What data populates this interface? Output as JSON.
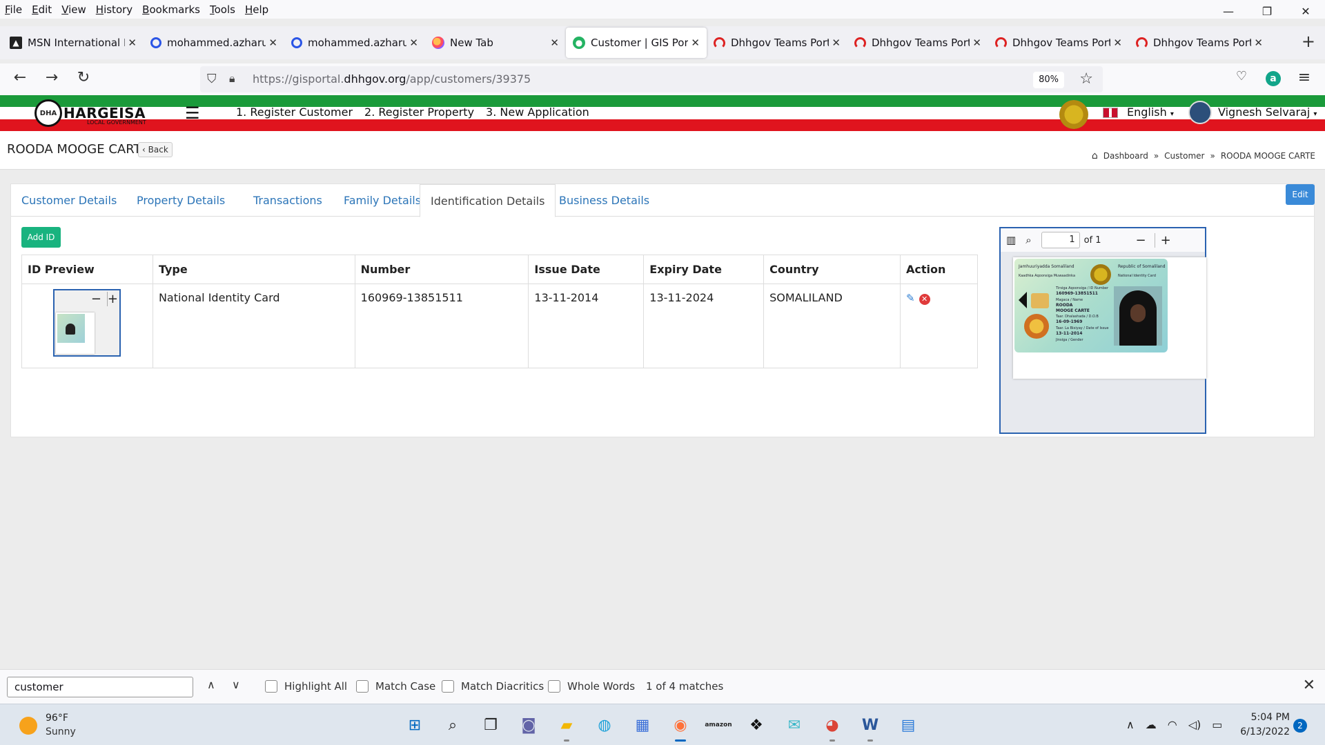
{
  "browser": {
    "menu": [
      "File",
      "Edit",
      "View",
      "History",
      "Bookmarks",
      "Tools",
      "Help"
    ],
    "window_controls": {
      "minimize": "—",
      "restore": "❐",
      "close": "✕"
    },
    "tabs": [
      {
        "title": "MSN International Ec",
        "icon": "msn-icon",
        "active": false
      },
      {
        "title": "mohammed.azharud",
        "icon": "blue-power-icon",
        "active": false
      },
      {
        "title": "mohammed.azharud",
        "icon": "blue-power-icon",
        "active": false
      },
      {
        "title": "New Tab",
        "icon": "firefox-icon",
        "active": false
      },
      {
        "title": "Customer | GIS Portal",
        "icon": "gis-portal-icon",
        "active": true
      },
      {
        "title": "Dhhgov Teams Portal",
        "icon": "teams-portal-icon",
        "active": false
      },
      {
        "title": "Dhhgov Teams Portal",
        "icon": "teams-portal-icon",
        "active": false
      },
      {
        "title": "Dhhgov Teams Porta",
        "icon": "teams-portal-icon",
        "active": false
      },
      {
        "title": "Dhhgov Teams Porta",
        "icon": "teams-portal-icon",
        "active": false
      }
    ],
    "url_prefix": "https://gisportal.",
    "url_domain": "dhhgov.org",
    "url_path": "/app/customers/39375",
    "zoom": "80%"
  },
  "site": {
    "logo_mark": "DHA",
    "logo_text": "HARGEISA",
    "logo_sub": "LOCAL GOVERNMENT",
    "top_links": [
      "1. Register Customer",
      "2. Register Property",
      "3. New Application"
    ],
    "language": "English",
    "user": "Vignesh Selvaraj"
  },
  "page": {
    "title": "ROODA MOOGE CARTE",
    "back_label": "Back",
    "breadcrumb": [
      "Dashboard",
      "Customer",
      "ROODA MOOGE CARTE"
    ]
  },
  "content": {
    "tabs": [
      "Customer Details",
      "Property Details",
      "Transactions",
      "Family Details",
      "Identification Details",
      "Business Details"
    ],
    "active_tab": "Identification Details",
    "edit_label": "Edit",
    "add_id_label": "Add ID",
    "table": {
      "headers": [
        "ID Preview",
        "Type",
        "Number",
        "Issue Date",
        "Expiry Date",
        "Country",
        "Action"
      ],
      "rows": [
        {
          "type": "National Identity Card",
          "number": "160969-13851511",
          "issue_date": "13-11-2014",
          "expiry_date": "13-11-2024",
          "country": "SOMALILAND"
        }
      ]
    },
    "viewer": {
      "page_number": "1",
      "page_of": "of 1",
      "card": {
        "left_header": "Jamhuuriyadda Somaliland",
        "right_header": "Republic of Somaliland",
        "sub_left": "Kaadhka Aqoonsiga Muwaadinka",
        "sub_right": "National Identity Card",
        "id_label": "Tirsiga Aqoonsiga / ID Number",
        "id_value": "160969-13851511",
        "name_label": "Magaca / Name",
        "name_line1": "ROODA",
        "name_line2": "MOOGE CARTE",
        "dob_label": "Taar. Dhalashada / D.O.B",
        "dob_value": "16-09-1969",
        "issue_label": "Taar. La Bixiyay / Date of Issue",
        "issue_value": "13-11-2014",
        "gender_label": "Jinsiga / Gender"
      }
    }
  },
  "find": {
    "query": "customer",
    "options": [
      "Highlight All",
      "Match Case",
      "Match Diacritics",
      "Whole Words"
    ],
    "status": "1 of 4 matches"
  },
  "taskbar": {
    "temperature": "96°F",
    "weather": "Sunny",
    "time": "5:04 PM",
    "date": "6/13/2022",
    "notifications": "2"
  }
}
